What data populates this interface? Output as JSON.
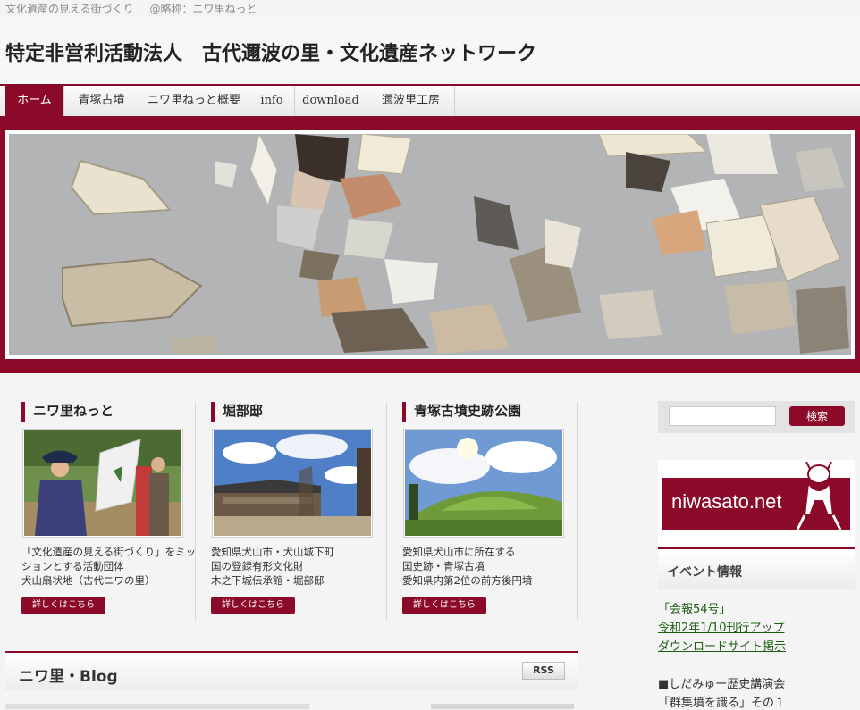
{
  "top_bar": {
    "tagline": "文化遺産の見える街づくり",
    "abbr": "@略称：ニワ里ねっと"
  },
  "header": {
    "title": "特定非営利活動法人　古代邇波の里・文化遺産ネットワーク"
  },
  "nav": {
    "items": [
      {
        "label": "ホーム",
        "active": true
      },
      {
        "label": "青塚古墳"
      },
      {
        "label": "ニワ里ねっと概要"
      },
      {
        "label": "info"
      },
      {
        "label": "download"
      },
      {
        "label": "邇波里工房"
      }
    ]
  },
  "colors": {
    "accent": "#8b0a2a",
    "link": "#1b5e10"
  },
  "cards": [
    {
      "title": "ニワ里ねっと",
      "lines": [
        "「文化遺産の見える街づくり」をミッ",
        "ションとする活動団体",
        "犬山扇状地（古代ニワの里）"
      ],
      "button": "詳しくはこちら"
    },
    {
      "title": "堀部邸",
      "lines": [
        "愛知県犬山市・犬山城下町",
        "国の登録有形文化財",
        "木之下城伝承館・堀部邸"
      ],
      "button": "詳しくはこちら"
    },
    {
      "title": "青塚古墳史跡公園",
      "lines": [
        "愛知県犬山市に所在する",
        "国史跡・青塚古墳",
        "愛知県内第2位の前方後円墳"
      ],
      "button": "詳しくはこちら"
    }
  ],
  "blog": {
    "title": "ニワ里・Blog",
    "rss": "RSS"
  },
  "sidebar": {
    "search_button": "検索",
    "search_value": "",
    "logo_text": "niwasato.net",
    "events_title": "イベント情報",
    "event_links": [
      "「会報54号」",
      "令和2年1/10刊行アップ",
      "ダウンロードサイト掲示"
    ],
    "event_text": [
      "■しだみゅー歴史講演会",
      "「群集墳を識る」その１"
    ]
  }
}
